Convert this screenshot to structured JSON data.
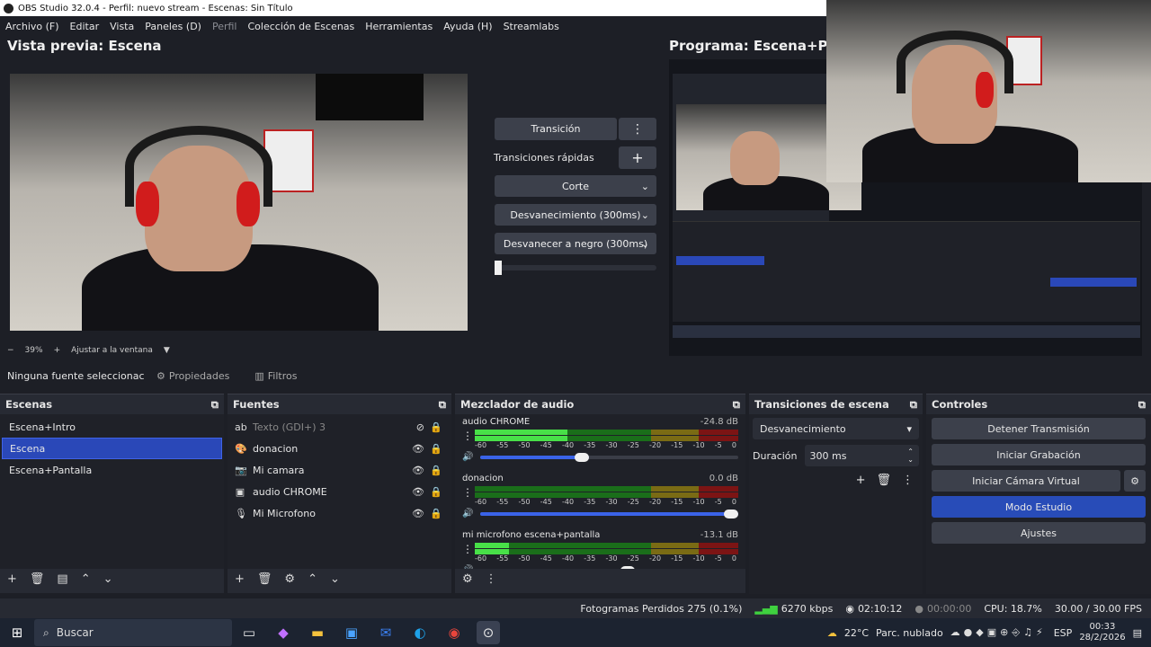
{
  "window": {
    "title": "OBS Studio 32.0.4 - Perfil: nuevo stream - Escenas: Sin Título"
  },
  "menu": [
    "Archivo (F)",
    "Editar",
    "Vista",
    "Paneles (D)",
    "Perfil",
    "Colección de Escenas",
    "Herramientas",
    "Ayuda (H)",
    "Streamlabs"
  ],
  "preview": {
    "title": "Vista previa: Escena",
    "zoom": "39%",
    "fit_label": "Ajustar a la ventana"
  },
  "program": {
    "title": "Programa: Escena+Pan"
  },
  "transition_panel": {
    "transition_btn": "Transición",
    "quick_label": "Transiciones rápidas",
    "options": [
      "Corte",
      "Desvanecimiento (300ms)",
      "Desvanecer a negro (300ms)"
    ]
  },
  "source_bar": {
    "none_selected": "Ninguna fuente seleccionac",
    "props": "Propiedades",
    "filters": "Filtros"
  },
  "scenes": {
    "title": "Escenas",
    "items": [
      "Escena+Intro",
      "Escena",
      "Escena+Pantalla"
    ],
    "selected": 1
  },
  "sources": {
    "title": "Fuentes",
    "items": [
      {
        "name": "Texto (GDI+) 3",
        "icon": "ab",
        "hidden": true
      },
      {
        "name": "donacion",
        "icon": "🎨",
        "hidden": false
      },
      {
        "name": "Mi camara",
        "icon": "📷",
        "hidden": false
      },
      {
        "name": "audio CHROME",
        "icon": "▣",
        "hidden": false
      },
      {
        "name": "Mi Microfono",
        "icon": "🎙",
        "hidden": false
      }
    ]
  },
  "mixer": {
    "title": "Mezclador de audio",
    "scale": [
      "-60",
      "-55",
      "-50",
      "-45",
      "-40",
      "-35",
      "-30",
      "-25",
      "-20",
      "-15",
      "-10",
      "-5",
      "0"
    ],
    "channels": [
      {
        "name": "audio CHROME",
        "db": "-24.8 dB",
        "level": 0.35,
        "volume": 0.42
      },
      {
        "name": "donacion",
        "db": "0.0 dB",
        "level": 0.0,
        "volume": 1.0
      },
      {
        "name": "mi microfono escena+pantalla",
        "db": "-13.1 dB",
        "level": 0.13,
        "volume": 0.6
      }
    ]
  },
  "scene_transitions": {
    "title": "Transiciones de escena",
    "selected": "Desvanecimiento",
    "duration_label": "Duración",
    "duration_value": "300 ms"
  },
  "controls": {
    "title": "Controles",
    "buttons": [
      "Detener Transmisión",
      "Iniciar Grabación",
      "Iniciar Cámara Virtual",
      "Modo Estudio",
      "Ajustes"
    ],
    "active": "Modo Estudio"
  },
  "status": {
    "dropped": "Fotogramas Perdidos 275 (0.1%)",
    "bitrate": "6270 kbps",
    "live_time": "02:10:12",
    "rec_time": "00:00:00",
    "cpu": "CPU: 18.7%",
    "fps": "30.00 / 30.00 FPS"
  },
  "taskbar": {
    "search": "Buscar",
    "weather_temp": "22°C",
    "weather_desc": "Parc. nublado",
    "lang": "ESP",
    "time": "00:33",
    "date": "28/2/2026"
  },
  "colors": {
    "accent": "#2a48b8",
    "bg": "#1d1f26",
    "panel": "#272a33"
  }
}
